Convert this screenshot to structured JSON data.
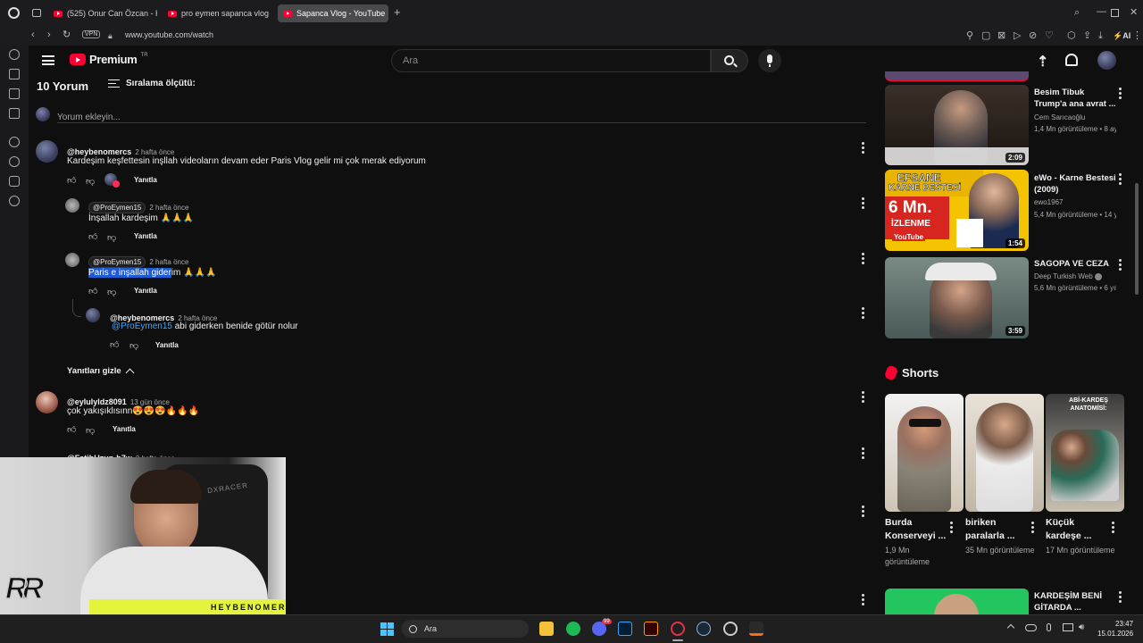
{
  "browser": {
    "tabs": [
      {
        "label": "(525) Onur Can Özcan - H"
      },
      {
        "label": "pro eymen sapanca vlog"
      },
      {
        "label": "Sapanca Vlog - YouTube"
      }
    ],
    "vpn_badge": "VPN",
    "url": "www.youtube.com/watch",
    "ai_label": "AI"
  },
  "youtube": {
    "logo_text": "Premium",
    "region": "TR",
    "search_placeholder": "Ara"
  },
  "comments": {
    "count_label": "10 Yorum",
    "sort_label": "Sıralama ölçütü:",
    "add_placeholder": "Yorum ekleyin...",
    "reply_label": "Yanıtla",
    "hide_replies_label": "Yanıtları gizle",
    "items": [
      {
        "author": "@heybenomercs",
        "time": "2 hafta önce",
        "text": "Kardeşim keşfettesin inşllah videoların devam eder Paris Vlog gelir mi çok merak ediyorum"
      },
      {
        "author": "@ProEymen15",
        "time": "2 hafta önce",
        "text": "İnşallah kardeşim 🙏🙏🙏"
      },
      {
        "author": "@ProEymen15",
        "time": "2 hafta önce",
        "text_selected": "Paris e inşallah gider",
        "text_rest": "im 🙏🙏🙏"
      },
      {
        "author": "@heybenomercs",
        "time": "2 hafta önce",
        "mention": "@ProEymen15",
        "text": " abi giderken benide götür nolur"
      },
      {
        "author": "@eylulyldz8091",
        "time": "13 gün önce",
        "text": "çok yakışıklısınn😍😍😍🔥🔥🔥"
      },
      {
        "author": "@FatihUzun-h7w",
        "time": "2 hafta önce",
        "text": ""
      }
    ]
  },
  "related": [
    {
      "title": "Besim Tibuk Trump'a ana avrat ...",
      "channel": "Cem Sarıcaoğlu",
      "meta": "1,4 Mn görüntüleme • 8 ay ...",
      "duration": "2:09"
    },
    {
      "title": "eWo - Karne Bestesi (2009)",
      "channel": "ewo1967",
      "meta": "5,4 Mn görüntüleme • 14 yıl ...",
      "duration": "1:54",
      "thumb_text1": "EFSANE",
      "thumb_text2": "KARNE BESTESİ",
      "thumb_text3": "6 Mn.",
      "thumb_text4": "İZLENME",
      "thumb_text5": "YouTube"
    },
    {
      "title": "SAGOPA VE CEZA",
      "channel": "Deep Turkish Web",
      "meta": "5,6 Mn görüntüleme • 6 yıl ...",
      "duration": "3:59"
    }
  ],
  "shorts": {
    "heading": "Shorts",
    "items": [
      {
        "title": "Burda Konserveyi ...",
        "views": "1,9 Mn görüntüleme"
      },
      {
        "title": "biriken paralarla ...",
        "views": "35 Mn görüntüleme"
      },
      {
        "title": "Küçük kardeşe ...",
        "views": "17 Mn görüntüleme",
        "thumb_text": "ABİ-KARDEŞ ANATOMİSİ:"
      }
    ]
  },
  "next_video": {
    "title": "KARDEŞİM BENİ GİTARDA ..."
  },
  "webcam": {
    "name": "HEYBENOMER",
    "chair_brand": "DXRACER"
  },
  "taskbar": {
    "search_label": "Ara",
    "time": "23:47",
    "date": "15.01.2026",
    "discord_badge": "99"
  },
  "colors": {
    "accent": "#ff0033",
    "selection": "#1d5bd6",
    "mention": "#3ea6ff",
    "webcam_bar": "#e4f43c"
  }
}
